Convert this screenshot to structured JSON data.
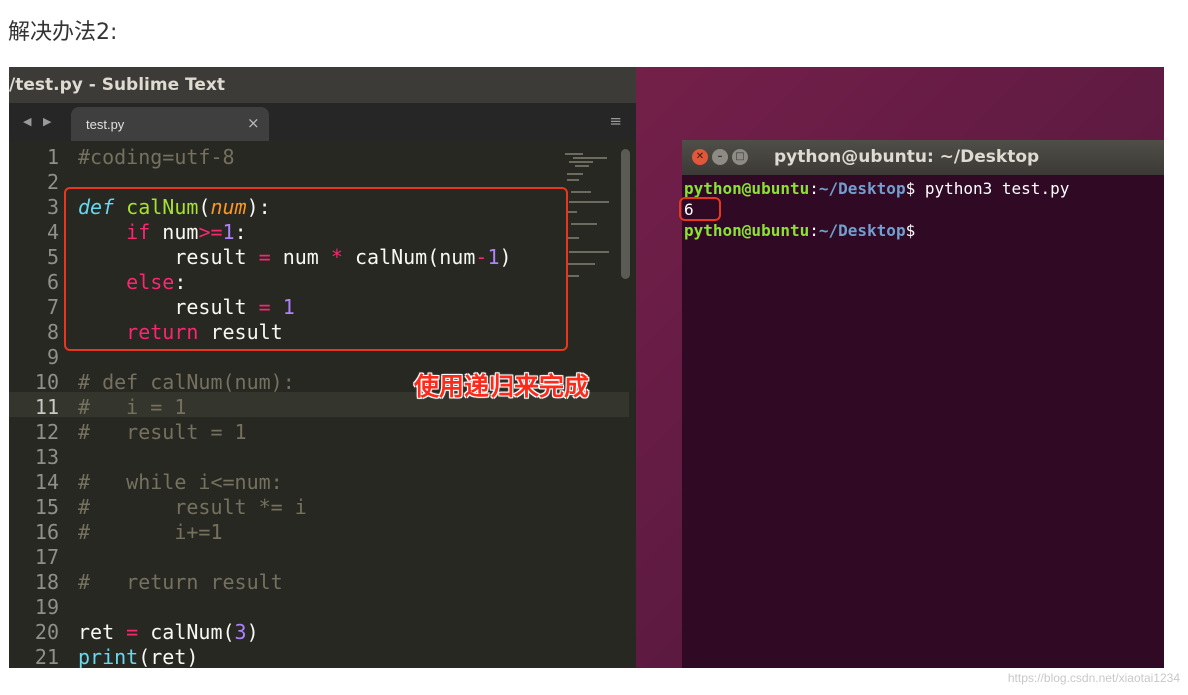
{
  "heading": "解决办法2:",
  "sublime": {
    "title": "/test.py - Sublime Text",
    "tab_label": "test.py",
    "tab_close": "×",
    "nav_arrows": "◀ ▶",
    "menu_icon": "≡",
    "line_numbers": [
      "1",
      "2",
      "3",
      "4",
      "5",
      "6",
      "7",
      "8",
      "9",
      "10",
      "11",
      "12",
      "13",
      "14",
      "15",
      "16",
      "17",
      "18",
      "19",
      "20",
      "21"
    ],
    "active_line": "11"
  },
  "annotation": "使用递归来完成",
  "terminal": {
    "title": "python@ubuntu: ~/Desktop",
    "prompt_user": "python@ubuntu",
    "prompt_path": "~/Desktop",
    "command": "python3 test.py",
    "output": "6"
  },
  "watermark": "https://blog.csdn.net/xiaotai1234",
  "colors": {
    "annotation_red": "#ff2a1a",
    "terminal_bg": "#300a24",
    "editor_bg": "#272822"
  }
}
